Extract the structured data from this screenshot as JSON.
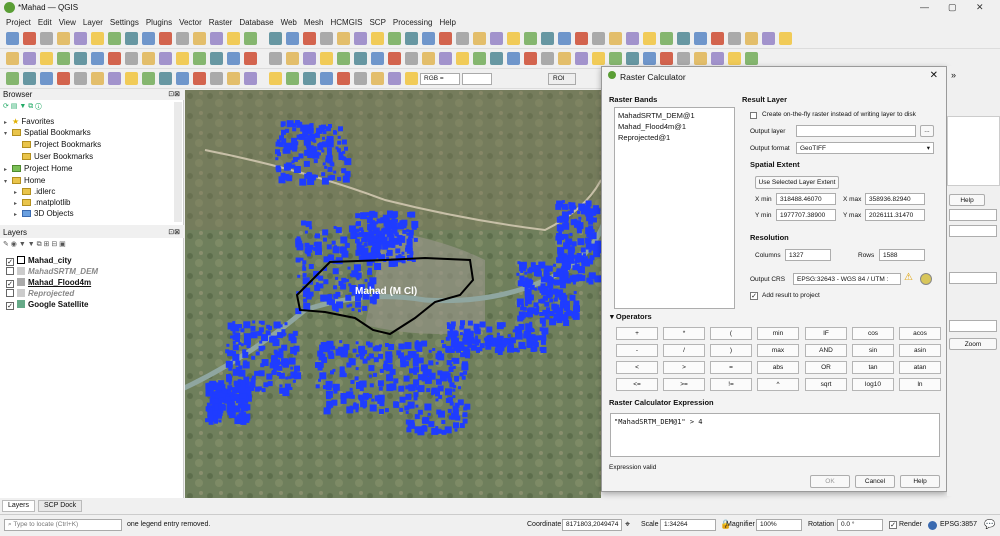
{
  "window": {
    "title": "*Mahad — QGIS",
    "min": "—",
    "max": "▢",
    "close": "✕"
  },
  "menu": [
    "Project",
    "Edit",
    "View",
    "Layer",
    "Settings",
    "Plugins",
    "Vector",
    "Raster",
    "Database",
    "Web",
    "Mesh",
    "HCMGIS",
    "SCP",
    "Processing",
    "Help"
  ],
  "toolbar": {
    "rgb_label": "RGB =",
    "roi_label": "ROI"
  },
  "browser": {
    "title": "Browser",
    "items": [
      "Favorites",
      "Spatial Bookmarks",
      "Project Bookmarks",
      "User Bookmarks",
      "Project Home",
      "Home",
      ".idlerc",
      ".matplotlib",
      "3D Objects"
    ]
  },
  "layers": {
    "title": "Layers",
    "items": [
      {
        "name": "Mahad_city",
        "checked": "✓"
      },
      {
        "name": "MahadSRTM_DEM",
        "checked": ""
      },
      {
        "name": "Mahad_Flood4m",
        "checked": "✓"
      },
      {
        "name": "Reprojected",
        "checked": ""
      },
      {
        "name": "Google Satellite",
        "checked": "✓"
      }
    ]
  },
  "bottom_tabs": {
    "layers": "Layers",
    "scp_dock": "SCP Dock"
  },
  "map": {
    "city_label": "Mahad (M Cl)"
  },
  "dialog": {
    "title": "Raster Calculator",
    "raster_bands_title": "Raster Bands",
    "bands": [
      "MahadSRTM_DEM@1",
      "Mahad_Flood4m@1",
      "Reprojected@1"
    ],
    "result_layer_title": "Result Layer",
    "onfly_label": "Create on-the-fly raster instead of writing layer to disk",
    "output_layer_label": "Output layer",
    "output_layer_value": "",
    "output_layer_browse": "...",
    "output_format_label": "Output format",
    "output_format_value": "GeoTIFF",
    "spatial_extent_title": "Spatial Extent",
    "use_selected_extent": "Use Selected Layer Extent",
    "xmin_label": "X min",
    "xmin_value": "318488.46070",
    "xmax_label": "X max",
    "xmax_value": "358936.82940",
    "ymin_label": "Y min",
    "ymin_value": "1977707.38900",
    "ymax_label": "Y max",
    "ymax_value": "2026111.31470",
    "resolution_title": "Resolution",
    "columns_label": "Columns",
    "columns_value": "1327",
    "rows_label": "Rows",
    "rows_value": "1588",
    "output_crs_label": "Output CRS",
    "output_crs_value": "EPSG:32643 - WGS 84 / UTM :",
    "add_result_label": "Add result to project",
    "add_result_check": "✓",
    "operators_title": "Operators",
    "operators": [
      [
        "+",
        "*",
        "(",
        "min",
        "IF",
        "cos",
        "acos"
      ],
      [
        "-",
        "/",
        ")",
        "max",
        "AND",
        "sin",
        "asin"
      ],
      [
        "<",
        ">",
        "=",
        "abs",
        "OR",
        "tan",
        "atan"
      ],
      [
        "<=",
        ">=",
        "!=",
        "^",
        "sqrt",
        "log10",
        "ln"
      ]
    ],
    "expression_title": "Raster Calculator Expression",
    "expression": "\"MahadSRTM_DEM@1\" > 4",
    "expression_status": "Expression valid",
    "ok": "OK",
    "cancel": "Cancel",
    "help": "Help"
  },
  "right_panel": {
    "help": "Help",
    "zoom": "Zoom"
  },
  "status": {
    "locate_placeholder": "Type to locate (Ctrl+K)",
    "message": "one legend entry removed.",
    "coordinate_label": "Coordinate",
    "coordinate_value": "8171803,2049474",
    "scale_label": "Scale",
    "scale_value": "1:34264",
    "magnifier_label": "Magnifier",
    "magnifier_value": "100%",
    "rotation_label": "Rotation",
    "rotation_value": "0.0 °",
    "render_label": "Render",
    "render_check": "✓",
    "crs": "EPSG:3857"
  },
  "colors": {
    "flood": "#1f3cff",
    "accent": "#5a9e35",
    "boundary": "#000000"
  }
}
